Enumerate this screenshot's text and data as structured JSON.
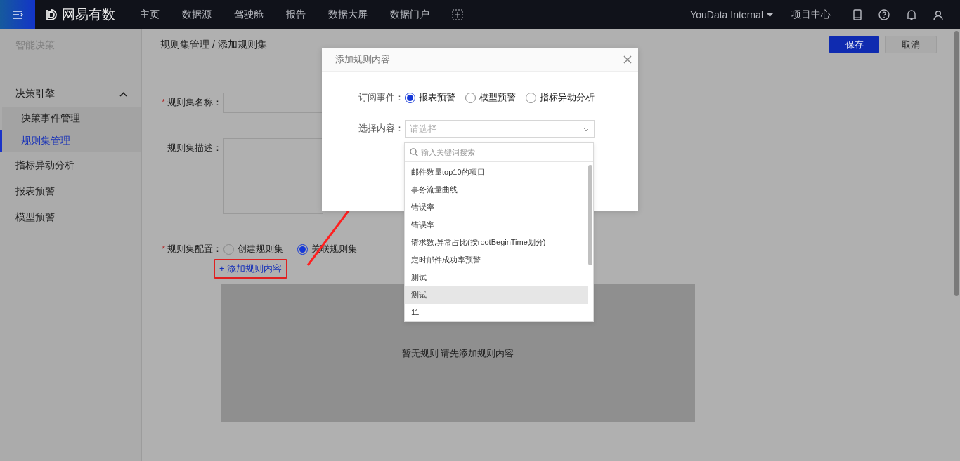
{
  "topbar": {
    "logo": "网易有数",
    "nav": [
      "主页",
      "数据源",
      "驾驶舱",
      "报告",
      "数据大屏",
      "数据门户"
    ],
    "workspace": "YouData Internal",
    "project_center": "项目中心"
  },
  "sidebar": {
    "title": "智能决策",
    "items": [
      {
        "label": "决策引擎",
        "expanded": true,
        "children": [
          {
            "label": "决策事件管理",
            "selected": false
          },
          {
            "label": "规则集管理",
            "selected": true
          }
        ]
      },
      {
        "label": "指标异动分析"
      },
      {
        "label": "报表预警"
      },
      {
        "label": "模型预警"
      }
    ]
  },
  "header": {
    "breadcrumb": "规则集管理 / 添加规则集",
    "buttons": [
      {
        "label": "保存",
        "kind": "primary"
      },
      {
        "label": "取消",
        "kind": "default"
      }
    ]
  },
  "form": {
    "required_marks": [
      "*",
      "*"
    ],
    "name_label": "规则集名称：",
    "desc_label": "规则集描述：",
    "config_label": "规则集配置：",
    "config_options": [
      {
        "label": "创建规则集",
        "selected": false
      },
      {
        "label": "关联规则集",
        "selected": true
      }
    ],
    "add_link": "+ 添加规则内容",
    "empty_text": "暂无规则 请先添加规则内容"
  },
  "modal": {
    "title": "添加规则内容",
    "event_label": "订阅事件：",
    "events": [
      {
        "label": "报表预警",
        "selected": true
      },
      {
        "label": "模型预警",
        "selected": false
      },
      {
        "label": "指标异动分析",
        "selected": false
      }
    ],
    "content_label": "选择内容：",
    "select_placeholder": "请选择",
    "dropdown": {
      "search_placeholder": "输入关键词搜索",
      "items": [
        {
          "label": "邮件数量top10的项目",
          "hovered": false
        },
        {
          "label": "事务流量曲线",
          "hovered": false
        },
        {
          "label": "错误率",
          "hovered": false
        },
        {
          "label": "错误率",
          "hovered": false
        },
        {
          "label": "请求数,异常占比(按rootBeginTime划分)",
          "hovered": false
        },
        {
          "label": "定时邮件成功率预警",
          "hovered": false
        },
        {
          "label": "测试",
          "hovered": false
        },
        {
          "label": "测试",
          "hovered": true
        },
        {
          "label": "11",
          "hovered": false
        }
      ]
    }
  }
}
